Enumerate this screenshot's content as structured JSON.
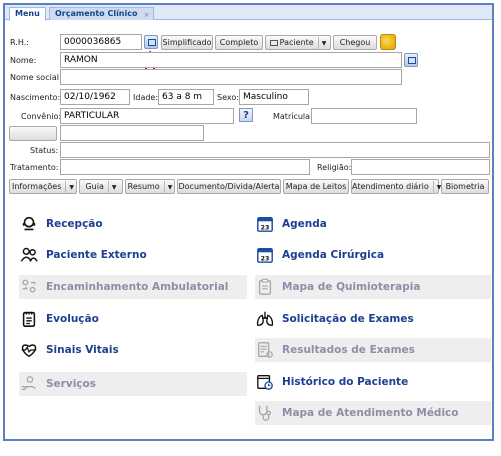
{
  "tabs": [
    {
      "label": "Menu",
      "active": true
    },
    {
      "label": "Orçamento Clínico",
      "active": false,
      "close": "×"
    }
  ],
  "form": {
    "rh_label": "R.H.:",
    "rh_value": "0000036865",
    "nome_label": "Nome:",
    "nome_value": "RAMON",
    "nome_social_label": "Nome social:",
    "nome_social_value": "",
    "nascimento_label": "Nascimento:",
    "nascimento_value": "02/10/1962",
    "idade_label": "Idade:",
    "idade_value": "63 a 8 m",
    "sexo_label": "Sexo:",
    "sexo_value": "Masculino",
    "convenio_label": "Convênio:",
    "convenio_value": "PARTICULAR",
    "matricula_label": "Matrícula:",
    "matricula_value": "",
    "help_label": "?",
    "status_label": "Status:",
    "status_value": "",
    "tratamento_label": "Tratamento:",
    "tratamento_value": "",
    "religiao_label": "Religião:",
    "religiao_value": ""
  },
  "toolbar": {
    "simplificado": "Simplificado",
    "completo": "Completo",
    "paciente": "Paciente",
    "chegou": "Chegou"
  },
  "action_bar": {
    "informacoes": "Informações",
    "guia": "Guia",
    "resumo": "Resumo",
    "documento": "Documento/Divida/Alerta",
    "mapa_leitos": "Mapa de Leitos",
    "atendimento_diario": "Atendimento diário",
    "biometria": "Biometria",
    "dropdown_arrow": "▼"
  },
  "menu_left": [
    {
      "label": "Recepção",
      "icon": "headset-icon",
      "enabled": true
    },
    {
      "label": "Paciente Externo",
      "icon": "people-icon",
      "enabled": true
    },
    {
      "label": "Encaminhamento Ambulatorial",
      "icon": "referral-icon",
      "enabled": false
    },
    {
      "label": "Evolução",
      "icon": "notepad-icon",
      "enabled": true
    },
    {
      "label": "Sinais Vitais",
      "icon": "heartbeat-icon",
      "enabled": true
    },
    {
      "label": "Serviços",
      "icon": "hand-service-icon",
      "enabled": false
    }
  ],
  "menu_right": [
    {
      "label": "Agenda",
      "icon": "calendar-icon",
      "enabled": true
    },
    {
      "label": "Agenda Cirúrgica",
      "icon": "calendar-icon",
      "enabled": true
    },
    {
      "label": "Mapa de Quimioterapia",
      "icon": "clipboard-icon",
      "enabled": false
    },
    {
      "label": "Solicitação de Exames",
      "icon": "lungs-icon",
      "enabled": true
    },
    {
      "label": "Resultados de Exames",
      "icon": "results-icon",
      "enabled": false
    },
    {
      "label": "Histórico do Paciente",
      "icon": "history-icon",
      "enabled": true
    },
    {
      "label": "Mapa de Atendimento Médico",
      "icon": "stethoscope-icon",
      "enabled": false
    }
  ],
  "calendar_day": "23",
  "colors": {
    "menu_text": "#1e3f8f",
    "disabled_text": "#8e8ea8",
    "annotation_arrow": "#e02020"
  }
}
